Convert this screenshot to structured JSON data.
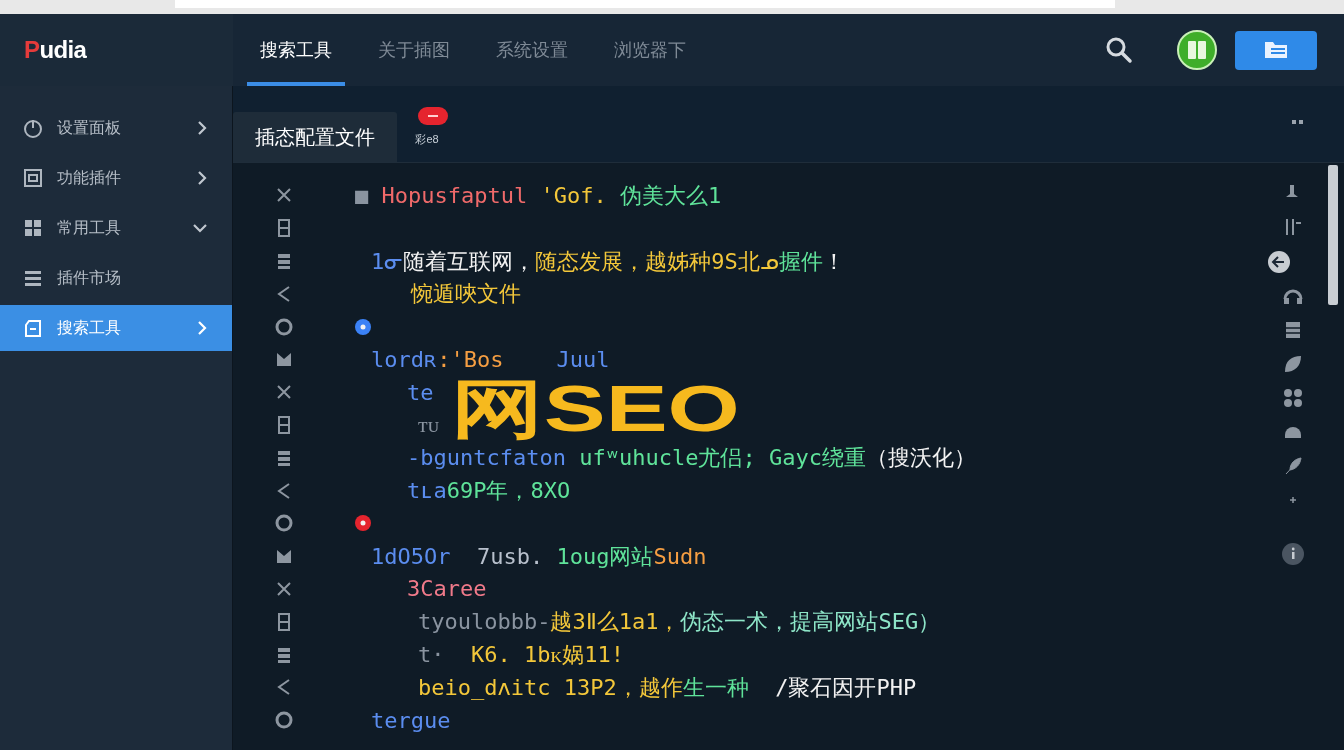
{
  "logo": {
    "mark": "P",
    "rest": "udia"
  },
  "header_tabs": [
    {
      "label": "搜索工具",
      "selected": true
    },
    {
      "label": "关于插图",
      "selected": false
    },
    {
      "label": "系统设置",
      "selected": false
    },
    {
      "label": "浏览器下",
      "selected": false
    }
  ],
  "sidebar": {
    "items": [
      {
        "label": "设置面板",
        "selected": false,
        "expanded": false
      },
      {
        "label": "功能插件",
        "selected": false,
        "expanded": false
      },
      {
        "label": "常用工具",
        "selected": false,
        "expanded": true
      },
      {
        "label": "插件市场",
        "selected": false
      },
      {
        "label": "搜索工具",
        "selected": true,
        "expanded": false
      }
    ]
  },
  "editor_tab": {
    "label": "插态配置文件",
    "note": "彩e8"
  },
  "overlay_title": "网SEO",
  "code_lines": [
    {
      "kind": "heading",
      "segments": [
        {
          "text": "■ ",
          "color": "#8a94a0"
        },
        {
          "text": "Hopusfaptul",
          "color": "#f06a6a"
        },
        {
          "text": " 'Gof.",
          "color": "#f3c73a"
        },
        {
          "text": " 伪美大么1",
          "color": "#5fe39a"
        }
      ]
    },
    {
      "kind": "empty"
    },
    {
      "kind": "statement",
      "segments": [
        {
          "text": "1ᓂ",
          "color": "#5b8def"
        },
        {
          "text": "随着互联网，",
          "color": "#f2f2f2"
        },
        {
          "text": "随态发展，越姊种9S北ᓄ",
          "color": "#f3c73a"
        },
        {
          "text": "握件",
          "color": "#5fe39a"
        },
        {
          "text": "！",
          "color": "#f2f2f2"
        }
      ]
    },
    {
      "kind": "continuation",
      "segments": [
        {
          "text": "惋遁唊文件",
          "color": "#f3c73a"
        }
      ]
    },
    {
      "kind": "marker",
      "color": "#3b82f6"
    },
    {
      "kind": "statement",
      "segments": [
        {
          "text": "lordʀ",
          "color": "#5b8def"
        },
        {
          "text": ":'Bos",
          "color": "#f59e42"
        },
        {
          "text": "    Juul",
          "color": "#5b8def"
        }
      ]
    },
    {
      "kind": "inner",
      "segments": [
        {
          "text": "te",
          "color": "#5b8def"
        }
      ]
    },
    {
      "kind": "deep",
      "segments": [
        {
          "text": "ᴛᴜ",
          "color": "#8a94a0"
        }
      ]
    },
    {
      "kind": "inner",
      "segments": [
        {
          "text": "-bguntcfaton",
          "color": "#5b8def"
        },
        {
          "text": " ufʷuhucle尤侣;",
          "color": "#5fe39a"
        },
        {
          "text": " Gayc绕重",
          "color": "#5fe39a"
        },
        {
          "text": "（搜沃化）",
          "color": "#f2f2f2"
        }
      ]
    },
    {
      "kind": "inner",
      "segments": [
        {
          "text": "tʟa",
          "color": "#5b8def"
        },
        {
          "text": "69P年，8XO",
          "color": "#5fe39a"
        }
      ]
    },
    {
      "kind": "marker",
      "color": "#e5242e"
    },
    {
      "kind": "statement",
      "segments": [
        {
          "text": "1dO5Or",
          "color": "#5b8def"
        },
        {
          "text": "  7usb.",
          "color": "#b8c0cc"
        },
        {
          "text": " 1oug网站",
          "color": "#5fe39a"
        },
        {
          "text": "Sudn",
          "color": "#f59e42"
        }
      ]
    },
    {
      "kind": "inner",
      "segments": [
        {
          "text": "3Caree",
          "color": "#f07a8a"
        }
      ]
    },
    {
      "kind": "deep",
      "segments": [
        {
          "text": "tyoulobbb-",
          "color": "#8a94a0"
        },
        {
          "text": "越3Ⅱ么1a1，",
          "color": "#f3c73a"
        },
        {
          "text": "伪态一术，提高网站SEG）",
          "color": "#8ee6c8"
        }
      ]
    },
    {
      "kind": "deep",
      "segments": [
        {
          "text": "t·",
          "color": "#8a94a0"
        },
        {
          "text": "  K6. 1bᴋ娲11!",
          "color": "#f3c73a"
        }
      ]
    },
    {
      "kind": "deep",
      "segments": [
        {
          "text": "beio_dʌitc 13P2，",
          "color": "#f3c73a"
        },
        {
          "text": "越作",
          "color": "#f3c73a"
        },
        {
          "text": "生一种",
          "color": "#5fe39a"
        },
        {
          "text": "  /聚石因开PHP",
          "color": "#f2f2f2"
        }
      ]
    },
    {
      "kind": "statement",
      "segments": [
        {
          "text": "tergue",
          "color": "#5b8def"
        }
      ]
    }
  ]
}
